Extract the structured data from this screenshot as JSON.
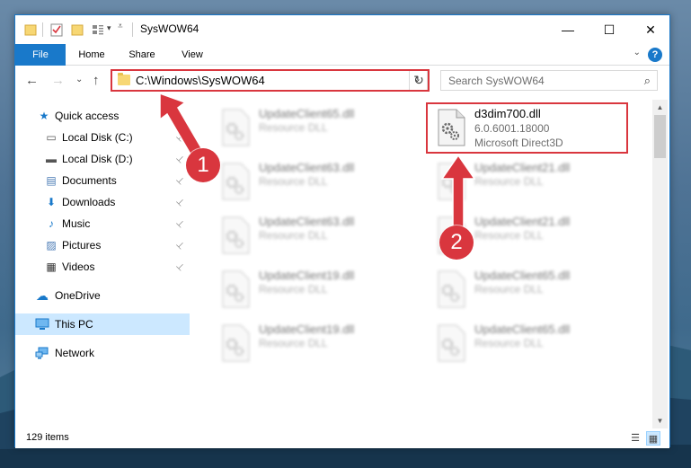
{
  "window": {
    "title": "SysWOW64",
    "minimize": "—",
    "maximize": "☐",
    "close": "✕"
  },
  "ribbon": {
    "tabs": [
      {
        "label": "File"
      },
      {
        "label": "Home"
      },
      {
        "label": "Share"
      },
      {
        "label": "View"
      }
    ],
    "help": "?",
    "expand": "⌄"
  },
  "nav": {
    "back": "←",
    "forward": "→",
    "recent": "⌄",
    "up": "↑",
    "address": "C:\\Windows\\SysWOW64",
    "address_dropdown": "⌄",
    "refresh": "↻",
    "search_placeholder": "Search SysWOW64",
    "search_icon": "⌕"
  },
  "sidebar": {
    "items": [
      {
        "label": "Quick access",
        "icon": "star-icon",
        "glyph": "★",
        "color": "#1979ca"
      },
      {
        "label": "Local Disk (C:)",
        "icon": "drive-icon",
        "glyph": "▭",
        "color": "#555555",
        "pinned": true
      },
      {
        "label": "Local Disk (D:)",
        "icon": "drive-icon",
        "glyph": "▬",
        "color": "#555555",
        "pinned": true
      },
      {
        "label": "Documents",
        "icon": "documents-icon",
        "glyph": "▤",
        "color": "#4a7bb5",
        "pinned": true
      },
      {
        "label": "Downloads",
        "icon": "downloads-icon",
        "glyph": "⬇",
        "color": "#1979ca",
        "pinned": true
      },
      {
        "label": "Music",
        "icon": "music-icon",
        "glyph": "♪",
        "color": "#1979ca",
        "pinned": true
      },
      {
        "label": "Pictures",
        "icon": "pictures-icon",
        "glyph": "▨",
        "color": "#4a7bb5",
        "pinned": true
      },
      {
        "label": "Videos",
        "icon": "videos-icon",
        "glyph": "▦",
        "color": "#333333",
        "pinned": true
      },
      {
        "label": "OneDrive",
        "icon": "onedrive-icon",
        "glyph": "☁",
        "color": "#1979ca"
      },
      {
        "label": "This PC",
        "icon": "computer-icon",
        "glyph": "▭",
        "color": "#1979ca",
        "selected": true
      },
      {
        "label": "Network",
        "icon": "network-icon",
        "glyph": "⊞",
        "color": "#1979ca"
      }
    ],
    "pin_glyph": "📌"
  },
  "files": [
    {
      "name": "UpdateClient65.dll",
      "type": "Resource DLL",
      "blurred": true
    },
    {
      "name": "d3dim700.dll",
      "version": "6.0.6001.18000",
      "description": "Microsoft Direct3D",
      "blurred": false,
      "highlighted": true
    },
    {
      "name": "UpdateClient63.dll",
      "type": "Resource DLL",
      "blurred": true
    },
    {
      "name": "UpdateClient21.dll",
      "type": "Resource DLL",
      "blurred": true
    },
    {
      "name": "UpdateClient63.dll",
      "type": "Resource DLL",
      "blurred": true
    },
    {
      "name": "UpdateClient21.dll",
      "type": "Resource DLL",
      "blurred": true
    },
    {
      "name": "UpdateClient19.dll",
      "type": "Resource DLL",
      "blurred": true
    },
    {
      "name": "UpdateClient65.dll",
      "type": "Resource DLL",
      "blurred": true
    },
    {
      "name": "UpdateClient19.dll",
      "type": "Resource DLL",
      "blurred": true
    },
    {
      "name": "UpdateClient65.dll",
      "type": "Resource DLL",
      "blurred": true
    }
  ],
  "status": {
    "item_count": "129 items",
    "details_view": "☰",
    "tiles_view": "▦"
  },
  "annotations": {
    "badge_1": "1",
    "badge_2": "2",
    "color": "#d9363e"
  },
  "scrollbar": {
    "up": "▲",
    "down": "▼"
  }
}
